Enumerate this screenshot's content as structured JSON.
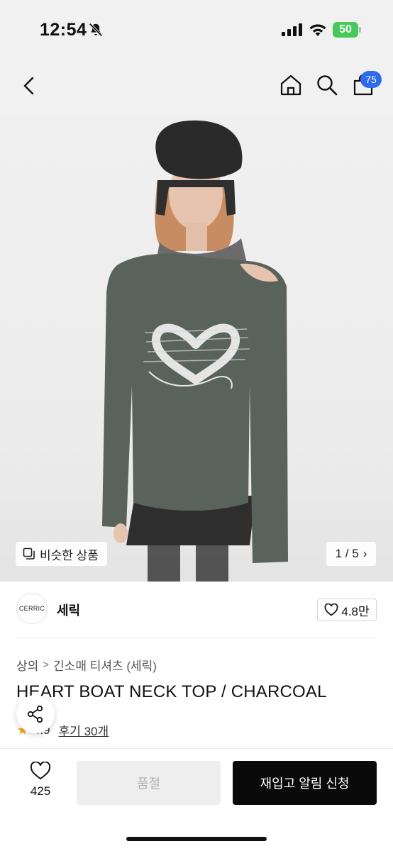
{
  "status_bar": {
    "time": "12:54",
    "battery": "50",
    "icons": [
      "bell-off-icon",
      "signal-icon",
      "wifi-icon",
      "battery-icon"
    ]
  },
  "header": {
    "icons": [
      "back-icon",
      "home-icon",
      "search-icon",
      "shopping-bag-icon"
    ],
    "cart_count": "75"
  },
  "gallery": {
    "similar_label": "비슷한 상품",
    "pager": "1 / 5",
    "chevron": "›"
  },
  "brand": {
    "logo_text": "CERRIC",
    "name": "세릭",
    "likes": "4.8만"
  },
  "product": {
    "breadcrumb": [
      "상의",
      "긴소매 티셔츠 (세릭)"
    ],
    "title": "HEART BOAT NECK TOP / CHARCOAL",
    "rating": "4.9",
    "review_link": "후기 30개"
  },
  "bottom_bar": {
    "wish_count": "425",
    "soldout_label": "품절",
    "restock_label": "재입고 알림 신청"
  },
  "colors": {
    "accent_badge": "#2f6bed",
    "battery": "#48c85a",
    "primary_button": "#0a0a0a",
    "star": "#f2a81d"
  }
}
